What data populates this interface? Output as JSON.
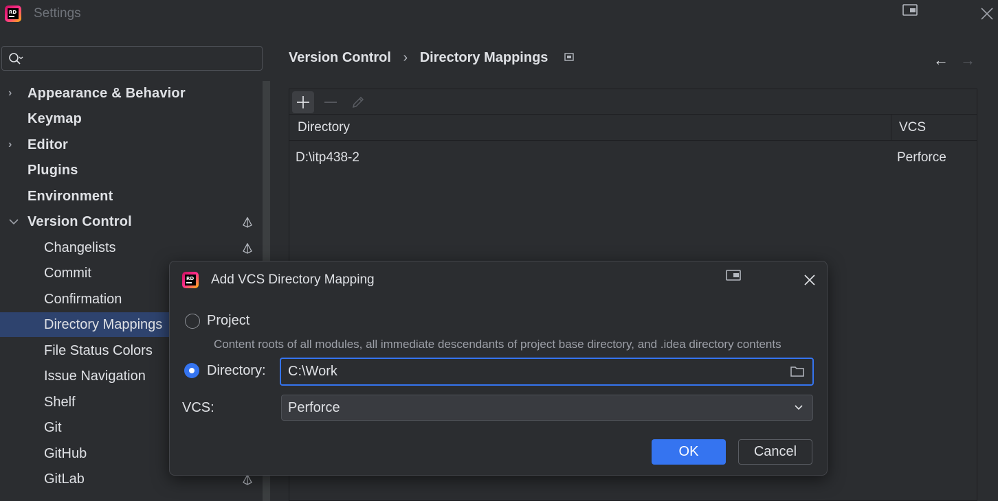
{
  "window": {
    "title": "Settings",
    "logo_text": "RD"
  },
  "search": {
    "placeholder": ""
  },
  "tree": {
    "items": [
      {
        "label": "Appearance & Behavior"
      },
      {
        "label": "Keymap"
      },
      {
        "label": "Editor"
      },
      {
        "label": "Plugins"
      },
      {
        "label": "Environment"
      },
      {
        "label": "Version Control"
      },
      {
        "label": "Changelists"
      },
      {
        "label": "Commit"
      },
      {
        "label": "Confirmation"
      },
      {
        "label": "Directory Mappings"
      },
      {
        "label": "File Status Colors"
      },
      {
        "label": "Issue Navigation"
      },
      {
        "label": "Shelf"
      },
      {
        "label": "Git"
      },
      {
        "label": "GitHub"
      },
      {
        "label": "GitLab"
      }
    ]
  },
  "breadcrumb": {
    "parent": "Version Control",
    "separator": "›",
    "current": "Directory Mappings"
  },
  "nav": {
    "back": "←",
    "forward": "→"
  },
  "table": {
    "columns": [
      "Directory",
      "VCS"
    ],
    "rows": [
      {
        "directory": "D:\\itp438-2",
        "vcs": "Perforce"
      }
    ]
  },
  "dialog": {
    "title": "Add VCS Directory Mapping",
    "logo_text": "RD",
    "project_label": "Project",
    "project_hint": "Content roots of all modules, all immediate descendants of project base directory, and .idea directory contents",
    "directory_label": "Directory:",
    "directory_value": "C:\\Work",
    "vcs_label": "VCS:",
    "vcs_value": "Perforce",
    "ok_label": "OK",
    "cancel_label": "Cancel"
  },
  "colors": {
    "accent": "#3574f0",
    "background": "#2b2d30",
    "selection": "#2e436e"
  }
}
